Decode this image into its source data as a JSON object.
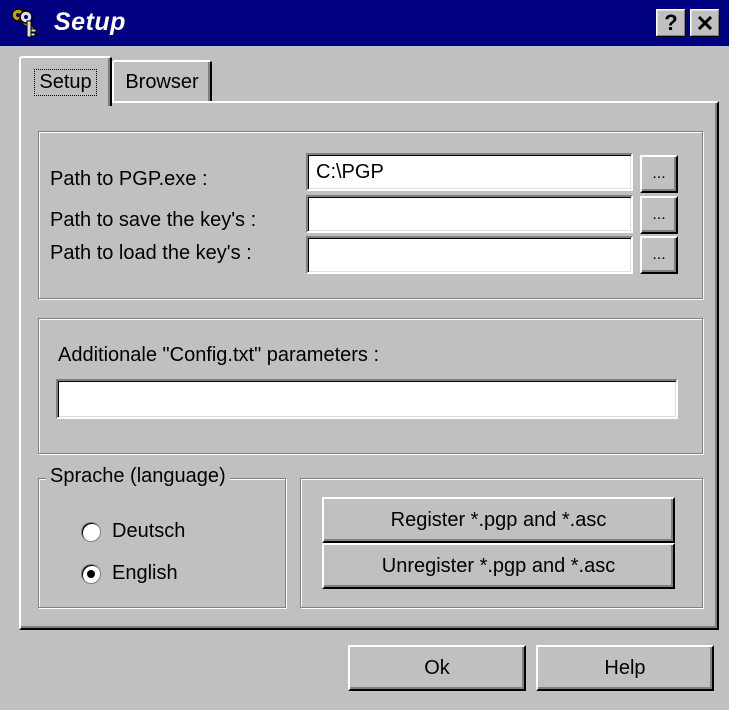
{
  "window": {
    "title": "Setup",
    "help_button": "?",
    "close_button": "✕"
  },
  "tabs": [
    {
      "label": "Setup",
      "active": true
    },
    {
      "label": "Browser",
      "active": false
    }
  ],
  "paths": {
    "pgp_label": "Path to PGP.exe :",
    "pgp_value": "C:\\PGP",
    "save_label": "Path to save the key's :",
    "save_value": "",
    "load_label": "Path to load the key's :",
    "load_value": "",
    "browse_label": "..."
  },
  "config": {
    "label": "Additionale \"Config.txt\" parameters :",
    "value": ""
  },
  "language": {
    "legend": "Sprache (language)",
    "options": [
      {
        "label": "Deutsch",
        "selected": false
      },
      {
        "label": "English",
        "selected": true
      }
    ]
  },
  "register": {
    "register_label": "Register *.pgp and *.asc",
    "unregister_label": "Unregister *.pgp and *.asc"
  },
  "footer": {
    "ok_label": "Ok",
    "help_label": "Help"
  },
  "colors": {
    "titlebar": "#000080",
    "face": "#c0c0c0"
  }
}
